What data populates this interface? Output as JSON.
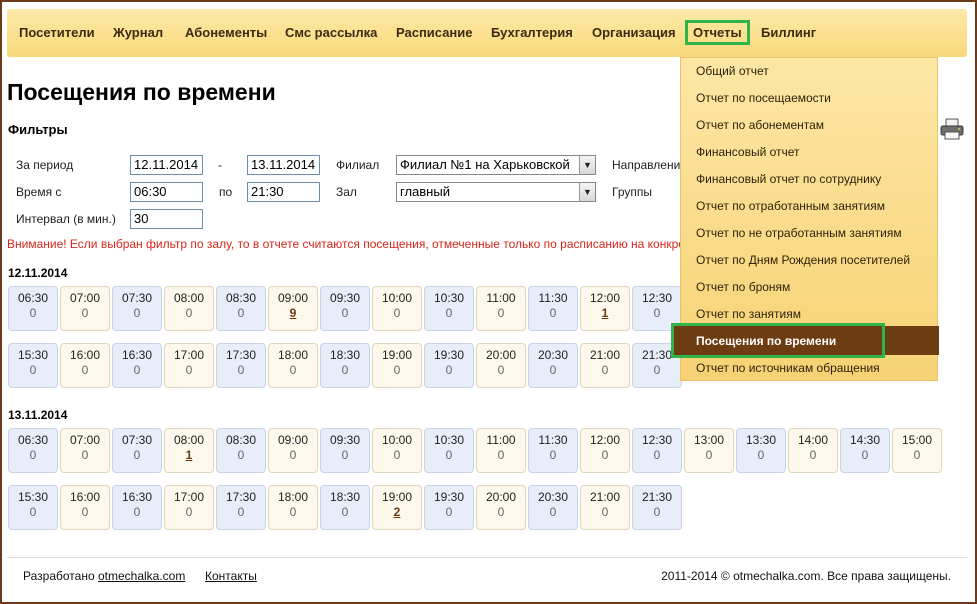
{
  "nav": {
    "items": [
      "Посетители",
      "Журнал",
      "Абонементы",
      "Смс рассылка",
      "Расписание",
      "Бухгалтерия",
      "Организация",
      "Отчеты",
      "Биллинг"
    ]
  },
  "page": {
    "title": "Посещения по времени",
    "filters_title": "Фильтры",
    "period_label": "За период",
    "period_from": "12.11.2014",
    "period_dash": "-",
    "period_to": "13.11.2014",
    "branch_label": "Филиал",
    "branch_value": "Филиал №1 на Харьковской",
    "direction_label": "Направления",
    "time_label": "Время с",
    "time_from": "06:30",
    "time_to_label": "по",
    "time_to": "21:30",
    "hall_label": "Зал",
    "hall_value": "главный",
    "groups_label": "Группы",
    "interval_label": "Интервал (в мин.)",
    "interval_value": "30",
    "warning": "Внимание! Если выбран фильтр по залу, то в отчете считаются посещения, отмеченные только по расписанию на конкретный зал."
  },
  "days": [
    {
      "date": "12.11.2014",
      "slots": [
        {
          "t": "06:30",
          "c": "0"
        },
        {
          "t": "07:00",
          "c": "0"
        },
        {
          "t": "07:30",
          "c": "0"
        },
        {
          "t": "08:00",
          "c": "0"
        },
        {
          "t": "08:30",
          "c": "0"
        },
        {
          "t": "09:00",
          "c": "9"
        },
        {
          "t": "09:30",
          "c": "0"
        },
        {
          "t": "10:00",
          "c": "0"
        },
        {
          "t": "10:30",
          "c": "0"
        },
        {
          "t": "11:00",
          "c": "0"
        },
        {
          "t": "11:30",
          "c": "0"
        },
        {
          "t": "12:00",
          "c": "1"
        },
        {
          "t": "12:30",
          "c": "0"
        },
        {
          "t": "15:30",
          "c": "0"
        },
        {
          "t": "16:00",
          "c": "0"
        },
        {
          "t": "16:30",
          "c": "0"
        },
        {
          "t": "17:00",
          "c": "0"
        },
        {
          "t": "17:30",
          "c": "0"
        },
        {
          "t": "18:00",
          "c": "0"
        },
        {
          "t": "18:30",
          "c": "0"
        },
        {
          "t": "19:00",
          "c": "0"
        },
        {
          "t": "19:30",
          "c": "0"
        },
        {
          "t": "20:00",
          "c": "0"
        },
        {
          "t": "20:30",
          "c": "0"
        },
        {
          "t": "21:00",
          "c": "0"
        },
        {
          "t": "21:30",
          "c": "0"
        }
      ]
    },
    {
      "date": "13.11.2014",
      "slots": [
        {
          "t": "06:30",
          "c": "0"
        },
        {
          "t": "07:00",
          "c": "0"
        },
        {
          "t": "07:30",
          "c": "0"
        },
        {
          "t": "08:00",
          "c": "1"
        },
        {
          "t": "08:30",
          "c": "0"
        },
        {
          "t": "09:00",
          "c": "0"
        },
        {
          "t": "09:30",
          "c": "0"
        },
        {
          "t": "10:00",
          "c": "0"
        },
        {
          "t": "10:30",
          "c": "0"
        },
        {
          "t": "11:00",
          "c": "0"
        },
        {
          "t": "11:30",
          "c": "0"
        },
        {
          "t": "12:00",
          "c": "0"
        },
        {
          "t": "12:30",
          "c": "0"
        },
        {
          "t": "13:00",
          "c": "0"
        },
        {
          "t": "13:30",
          "c": "0"
        },
        {
          "t": "14:00",
          "c": "0"
        },
        {
          "t": "14:30",
          "c": "0"
        },
        {
          "t": "15:00",
          "c": "0"
        },
        {
          "t": "15:30",
          "c": "0"
        },
        {
          "t": "16:00",
          "c": "0"
        },
        {
          "t": "16:30",
          "c": "0"
        },
        {
          "t": "17:00",
          "c": "0"
        },
        {
          "t": "17:30",
          "c": "0"
        },
        {
          "t": "18:00",
          "c": "0"
        },
        {
          "t": "18:30",
          "c": "0"
        },
        {
          "t": "19:00",
          "c": "2"
        },
        {
          "t": "19:30",
          "c": "0"
        },
        {
          "t": "20:00",
          "c": "0"
        },
        {
          "t": "20:30",
          "c": "0"
        },
        {
          "t": "21:00",
          "c": "0"
        },
        {
          "t": "21:30",
          "c": "0"
        }
      ]
    }
  ],
  "reports_menu": {
    "items": [
      "Общий отчет",
      "Отчет по посещаемости",
      "Отчет по абонементам",
      "Финансовый отчет",
      "Финансовый отчет по сотруднику",
      "Отчет по отработанным занятиям",
      "Отчет по не отработанным занятиям",
      "Отчет по Дням Рождения посетителей",
      "Отчет по броням",
      "Отчет по занятиям",
      "Посещения по времени",
      "Отчет по источникам обращения"
    ]
  },
  "footer": {
    "developed_prefix": "Разработано",
    "developed_link": "otmechalka.com",
    "contacts": "Контакты",
    "copyright": "2011-2014 © otmechalka.com. Все права защищены."
  }
}
